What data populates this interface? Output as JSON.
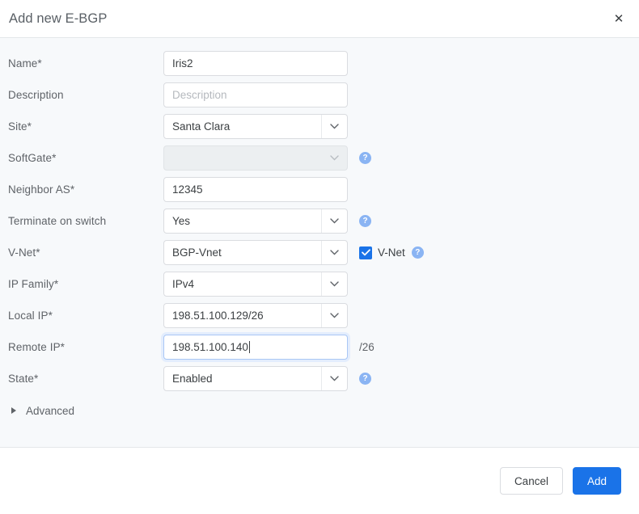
{
  "dialog": {
    "title": "Add new E-BGP",
    "close_label": "✕"
  },
  "form": {
    "rows": [
      {
        "label": "Name*",
        "control": "text",
        "value": "Iris2",
        "placeholder": "",
        "help": false
      },
      {
        "label": "Description",
        "control": "text",
        "value": "",
        "placeholder": "Description",
        "help": false
      },
      {
        "label": "Site*",
        "control": "select",
        "value": "Santa Clara",
        "help": false
      },
      {
        "label": "SoftGate*",
        "control": "select-disabled",
        "value": "",
        "help": true
      },
      {
        "label": "Neighbor AS*",
        "control": "text",
        "value": "12345",
        "placeholder": "",
        "help": false
      },
      {
        "label": "Terminate on switch",
        "control": "select",
        "value": "Yes",
        "help": true
      },
      {
        "label": "V-Net*",
        "control": "select",
        "value": "BGP-Vnet",
        "help": true,
        "checkbox": {
          "label": "V-Net",
          "checked": true
        }
      },
      {
        "label": "IP Family*",
        "control": "select",
        "value": "IPv4",
        "help": false
      },
      {
        "label": "Local IP*",
        "control": "select",
        "value": "198.51.100.129/26",
        "help": false
      },
      {
        "label": "Remote IP*",
        "control": "text-focused",
        "value": "198.51.100.140",
        "placeholder": "",
        "suffix": "/26",
        "help": false
      },
      {
        "label": "State*",
        "control": "select",
        "value": "Enabled",
        "help": true
      }
    ],
    "advanced": {
      "label": "Advanced",
      "expanded": false
    },
    "help_glyph": "?"
  },
  "footer": {
    "cancel_label": "Cancel",
    "submit_label": "Add"
  },
  "colors": {
    "primary": "#1a73e8",
    "help_icon": "#8ab4f3",
    "body_bg": "#f7f9fb",
    "label": "#5f6368",
    "border": "#dadce0",
    "focus_ring": "#e3edfd"
  }
}
